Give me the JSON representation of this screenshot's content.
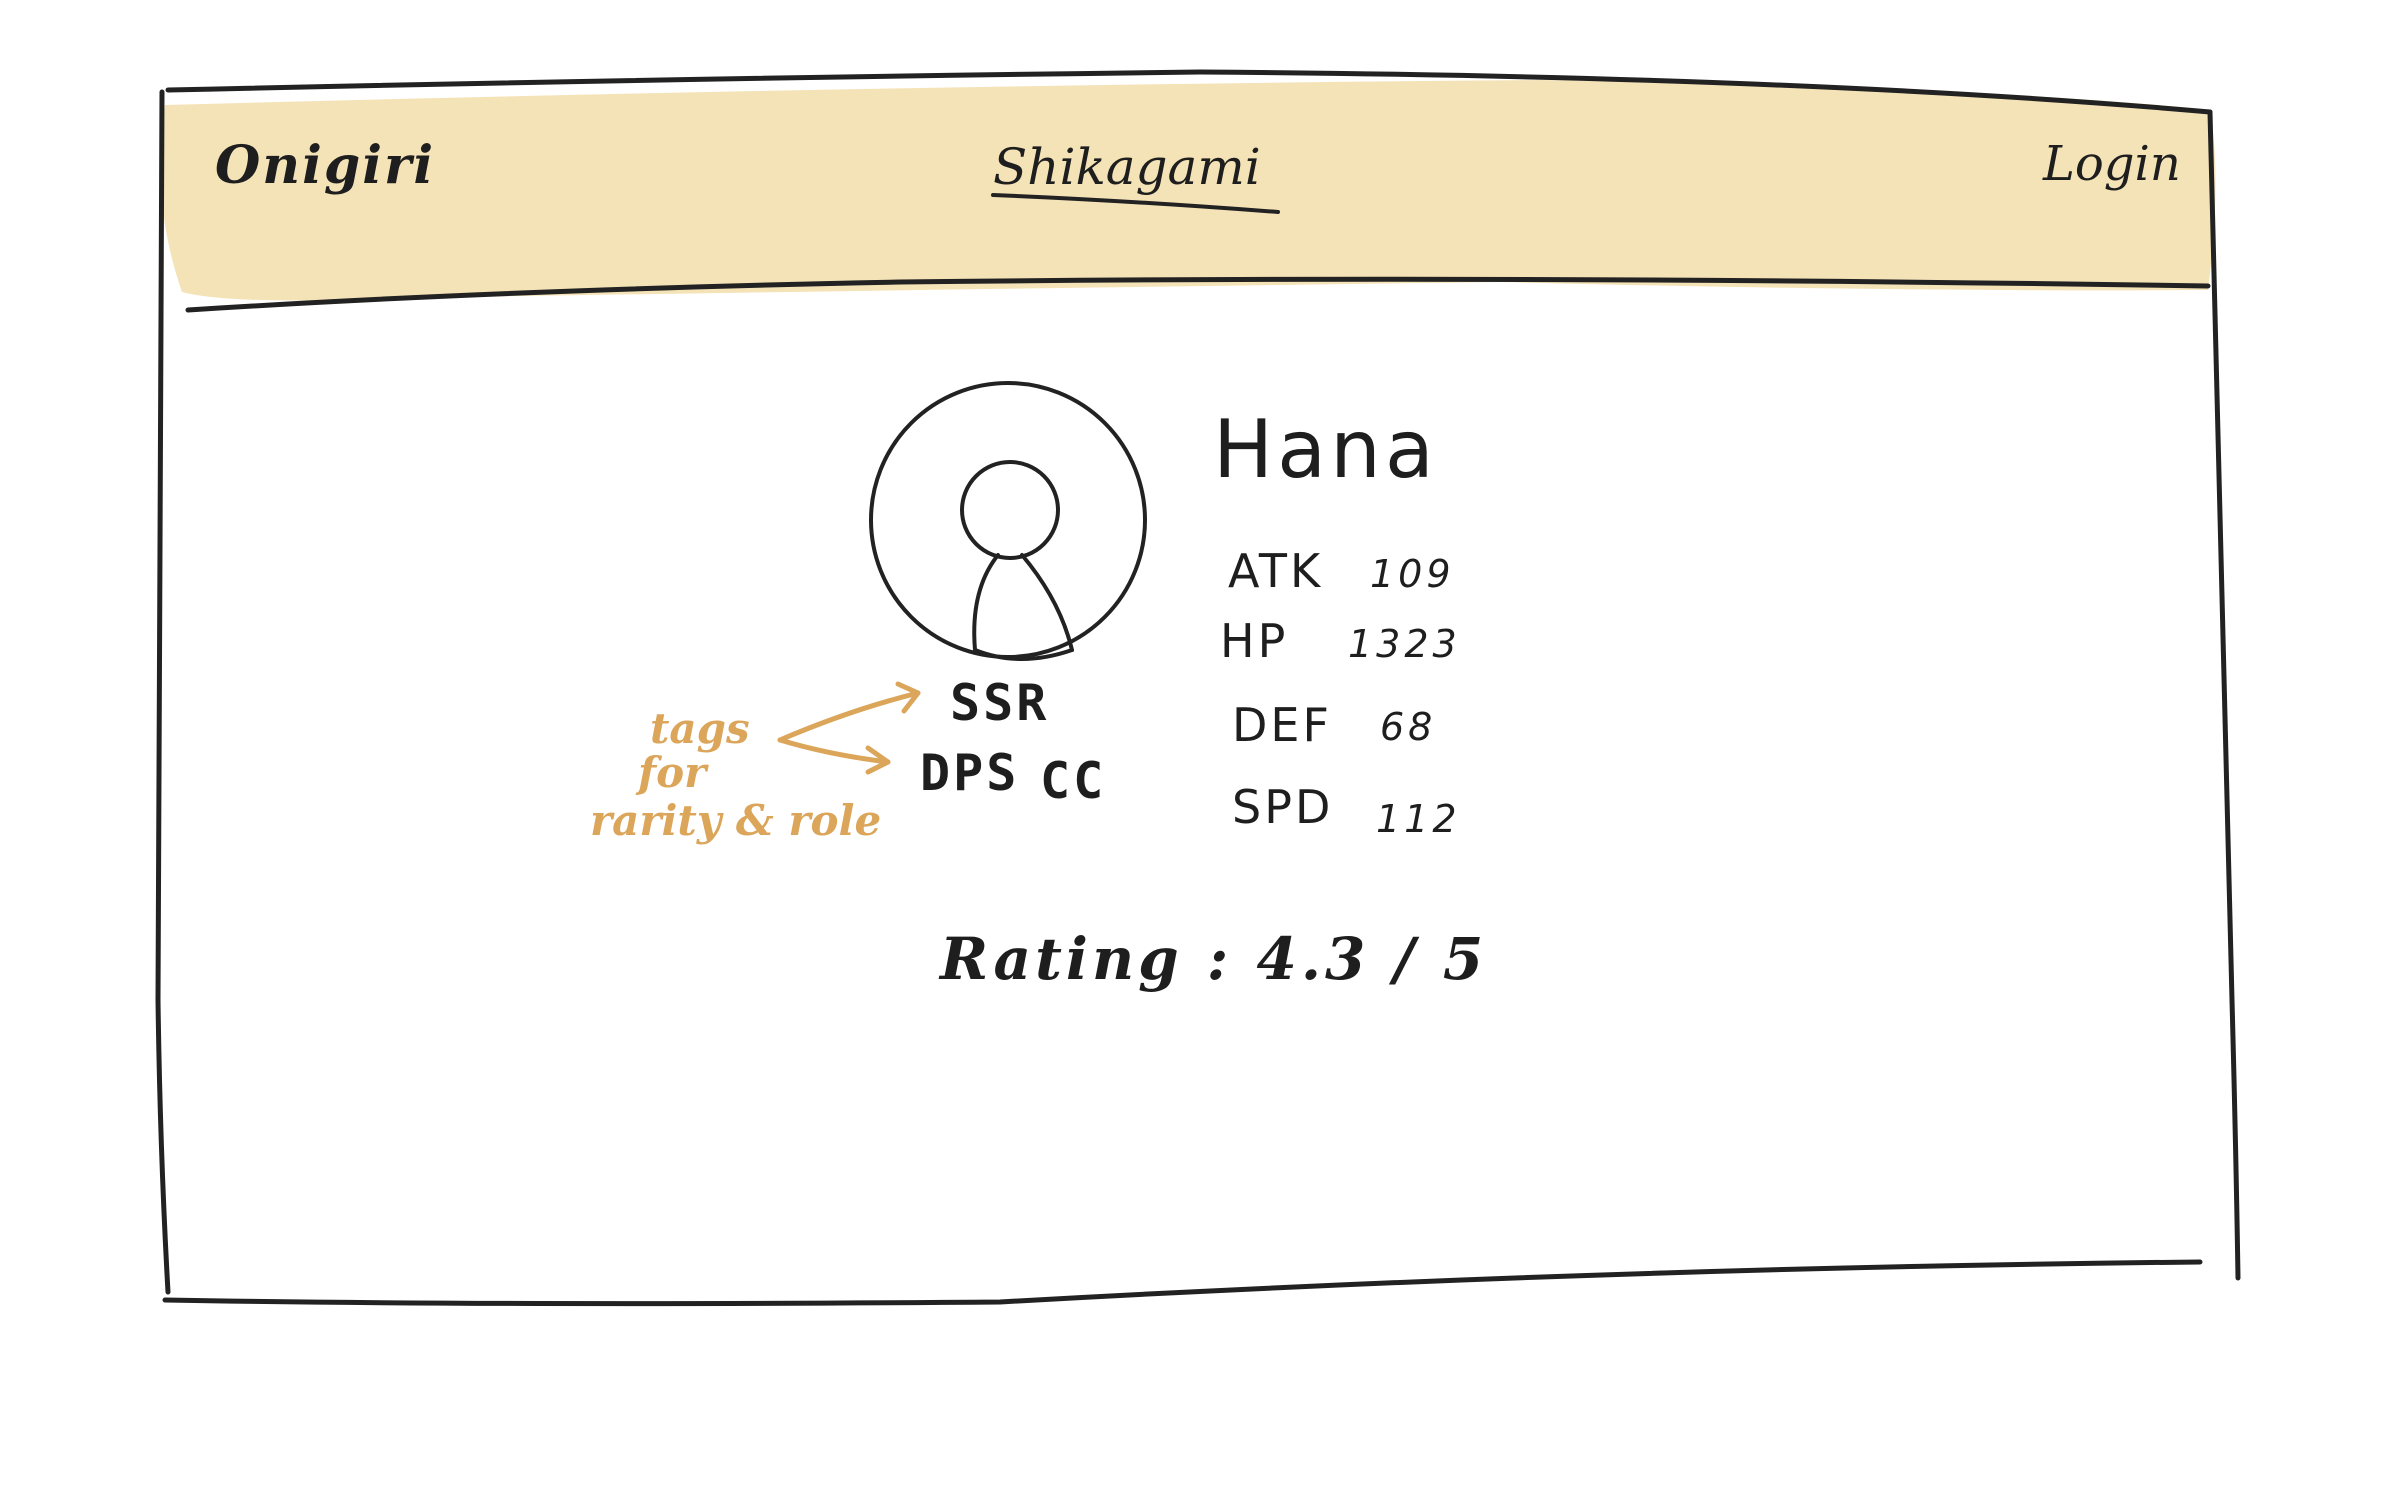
{
  "header": {
    "logo_text": "Onigiri",
    "site_title": "Shikagami",
    "login_label": "Login"
  },
  "character": {
    "name": "Hana",
    "portrait_icon": "user-portrait-icon",
    "stats": [
      {
        "label": "ATK",
        "value": "109"
      },
      {
        "label": "HP",
        "value": "1323"
      },
      {
        "label": "DEF",
        "value": "68"
      },
      {
        "label": "SPD",
        "value": "112"
      }
    ],
    "tags": [
      {
        "label": "SSR"
      },
      {
        "label": "DPS"
      },
      {
        "label": "CC"
      }
    ],
    "rating": "Rating : 4.3 / 5"
  },
  "annotation": {
    "lines": [
      "tags",
      "for",
      "rarity & role"
    ]
  },
  "colors": {
    "header_fill": "#f5e3b8",
    "annotation": "#dba55a",
    "ink": "#1e1e1e"
  }
}
